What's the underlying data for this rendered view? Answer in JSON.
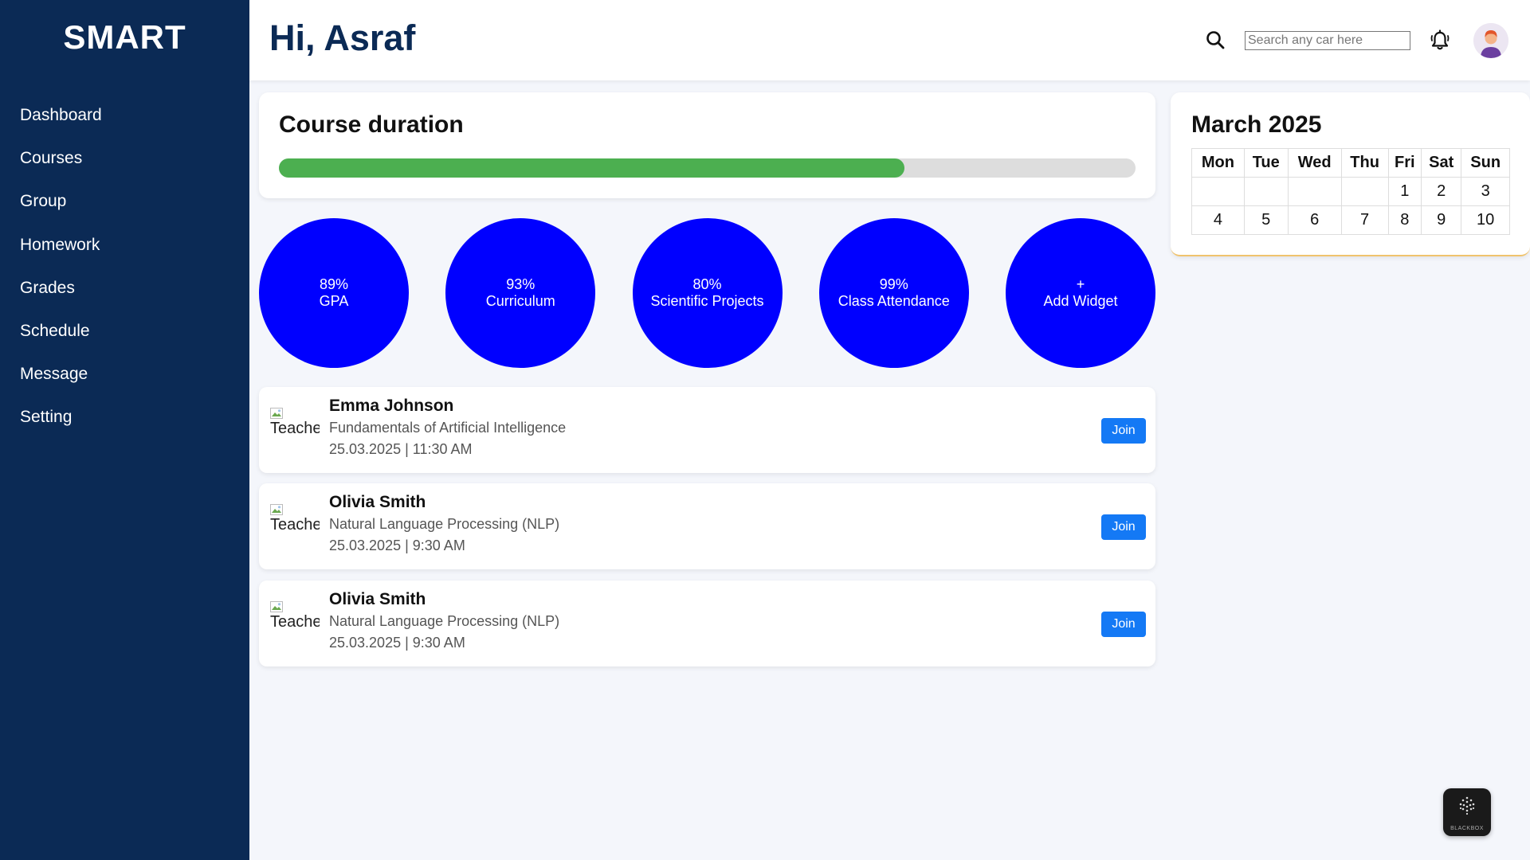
{
  "app": {
    "logo": "SMART"
  },
  "sidebar": {
    "items": [
      {
        "label": "Dashboard"
      },
      {
        "label": "Courses"
      },
      {
        "label": "Group"
      },
      {
        "label": "Homework"
      },
      {
        "label": "Grades"
      },
      {
        "label": "Schedule"
      },
      {
        "label": "Message"
      },
      {
        "label": "Setting"
      }
    ]
  },
  "header": {
    "greeting": "Hi, Asraf",
    "search_placeholder": "Search any car here"
  },
  "course_duration": {
    "title": "Course duration",
    "progress_fraction": 0.73
  },
  "stats": [
    {
      "value": "89%",
      "label": "GPA"
    },
    {
      "value": "93%",
      "label": "Curriculum"
    },
    {
      "value": "80%",
      "label": "Scientific Projects"
    },
    {
      "value": "99%",
      "label": "Class Attendance"
    },
    {
      "value": "+",
      "label": "Add Widget"
    }
  ],
  "lessons": [
    {
      "image_alt": "Teacher",
      "teacher": "Emma Johnson",
      "course": "Fundamentals of Artificial Intelligence",
      "datetime": "25.03.2025 | 11:30 AM",
      "action": "Join"
    },
    {
      "image_alt": "Teacher",
      "teacher": "Olivia Smith",
      "course": "Natural Language Processing (NLP)",
      "datetime": "25.03.2025 | 9:30 AM",
      "action": "Join"
    },
    {
      "image_alt": "Teacher",
      "teacher": "Olivia Smith",
      "course": "Natural Language Processing (NLP)",
      "datetime": "25.03.2025 | 9:30 AM",
      "action": "Join"
    }
  ],
  "calendar": {
    "title": "March 2025",
    "weekdays": [
      "Mon",
      "Tue",
      "Wed",
      "Thu",
      "Fri",
      "Sat",
      "Sun"
    ],
    "weeks": [
      [
        "",
        "",
        "",
        "",
        "1",
        "2",
        "3"
      ],
      [
        "4",
        "5",
        "6",
        "7",
        "8",
        "9",
        "10"
      ]
    ]
  },
  "badge": {
    "text": "BLACKBOX"
  },
  "colors": {
    "sidebar_bg": "#0b2a55",
    "accent_blue": "#0000ff",
    "progress_green": "#4caf50",
    "join_button": "#1479f5"
  },
  "icons": {
    "search": "search-icon",
    "notifications": "bell-icon",
    "user": "avatar"
  }
}
